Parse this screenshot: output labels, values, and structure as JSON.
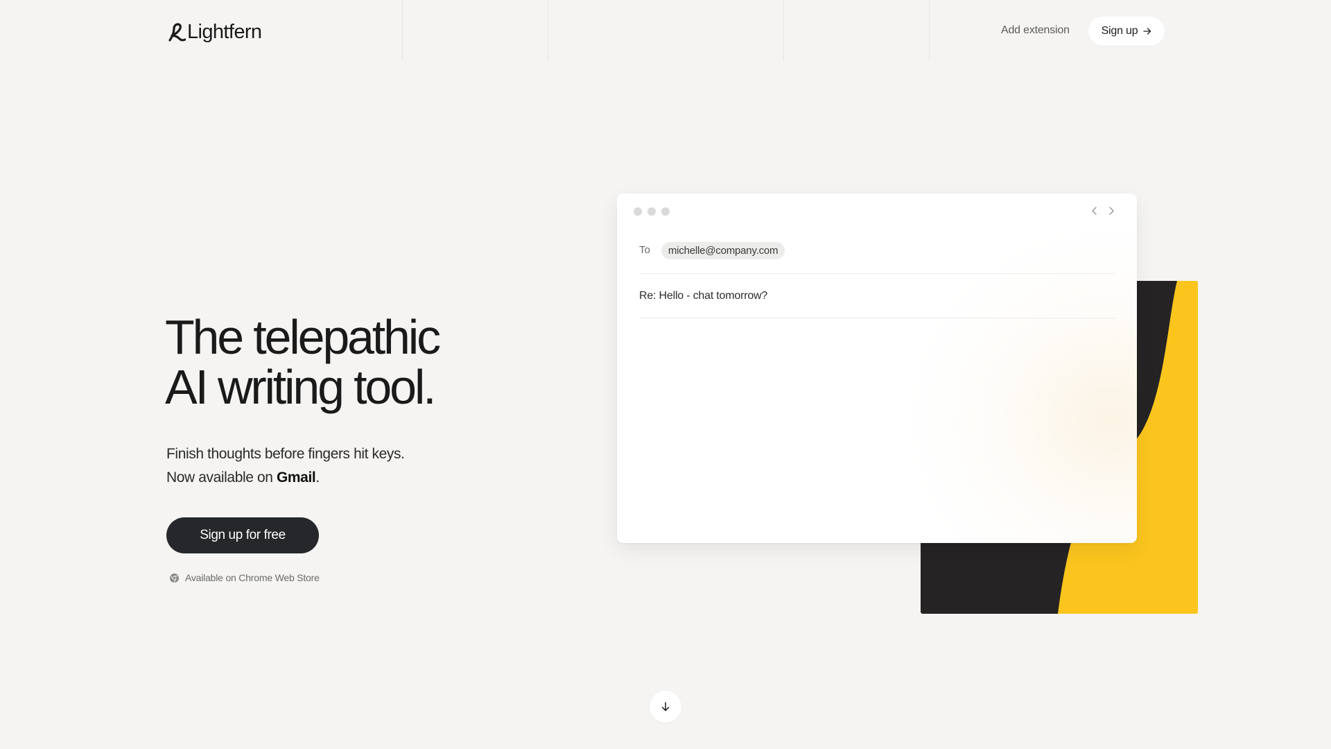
{
  "header": {
    "brand": "Lightfern",
    "add_extension": "Add extension",
    "signup": "Sign up"
  },
  "hero": {
    "headline_line1": "The telepathic",
    "headline_line2": "AI writing tool.",
    "subtext_line1": "Finish thoughts before fingers hit keys.",
    "subtext_line2_prefix": "Now available on ",
    "subtext_line2_bold": "Gmail",
    "subtext_line2_suffix": ".",
    "cta": "Sign up for free",
    "store_note": "Available on Chrome Web Store"
  },
  "email": {
    "to_label": "To",
    "recipient": "michelle@company.com",
    "subject": "Re: Hello - chat tomorrow?"
  },
  "icons": {
    "logo": "lightfern-logo-icon",
    "arrow": "arrow-right-icon",
    "chrome": "chrome-icon",
    "prev": "chevron-left-icon",
    "next": "chevron-right-icon",
    "scroll": "arrow-down-icon"
  },
  "colors": {
    "background": "#f5f4f2",
    "cta": "#25272a",
    "accent_yellow": "#fbc51e",
    "accent_dark": "#252323"
  }
}
